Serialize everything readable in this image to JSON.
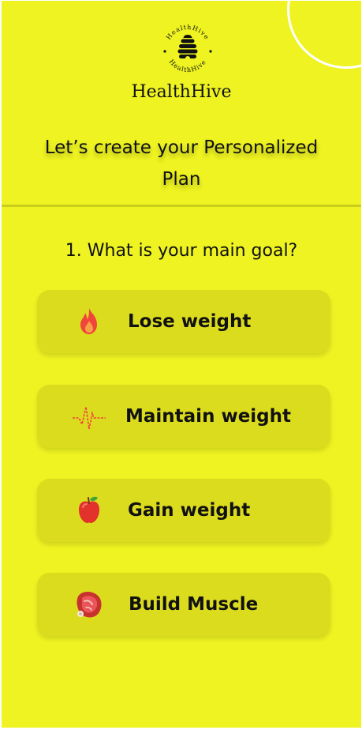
{
  "brand": {
    "name": "HealthHive",
    "badge_top_text": "HealthHive",
    "badge_bottom_text": "HealthHive",
    "logo_icon": "beehive-icon"
  },
  "header": {
    "title": "Let’s create your Personalized Plan"
  },
  "question": {
    "text": "1. What is your main goal?"
  },
  "options": [
    {
      "label": "Lose weight",
      "icon": "fire-icon"
    },
    {
      "label": "Maintain weight",
      "icon": "heartbeat-icon"
    },
    {
      "label": "Gain weight",
      "icon": "apple-icon"
    },
    {
      "label": "Build Muscle",
      "icon": "meat-icon"
    }
  ],
  "colors": {
    "background": "#eef321",
    "option_card": "#dcdc1f",
    "divider": "#c9ce1a",
    "text": "#111111",
    "accent_red": "#f0453a"
  }
}
